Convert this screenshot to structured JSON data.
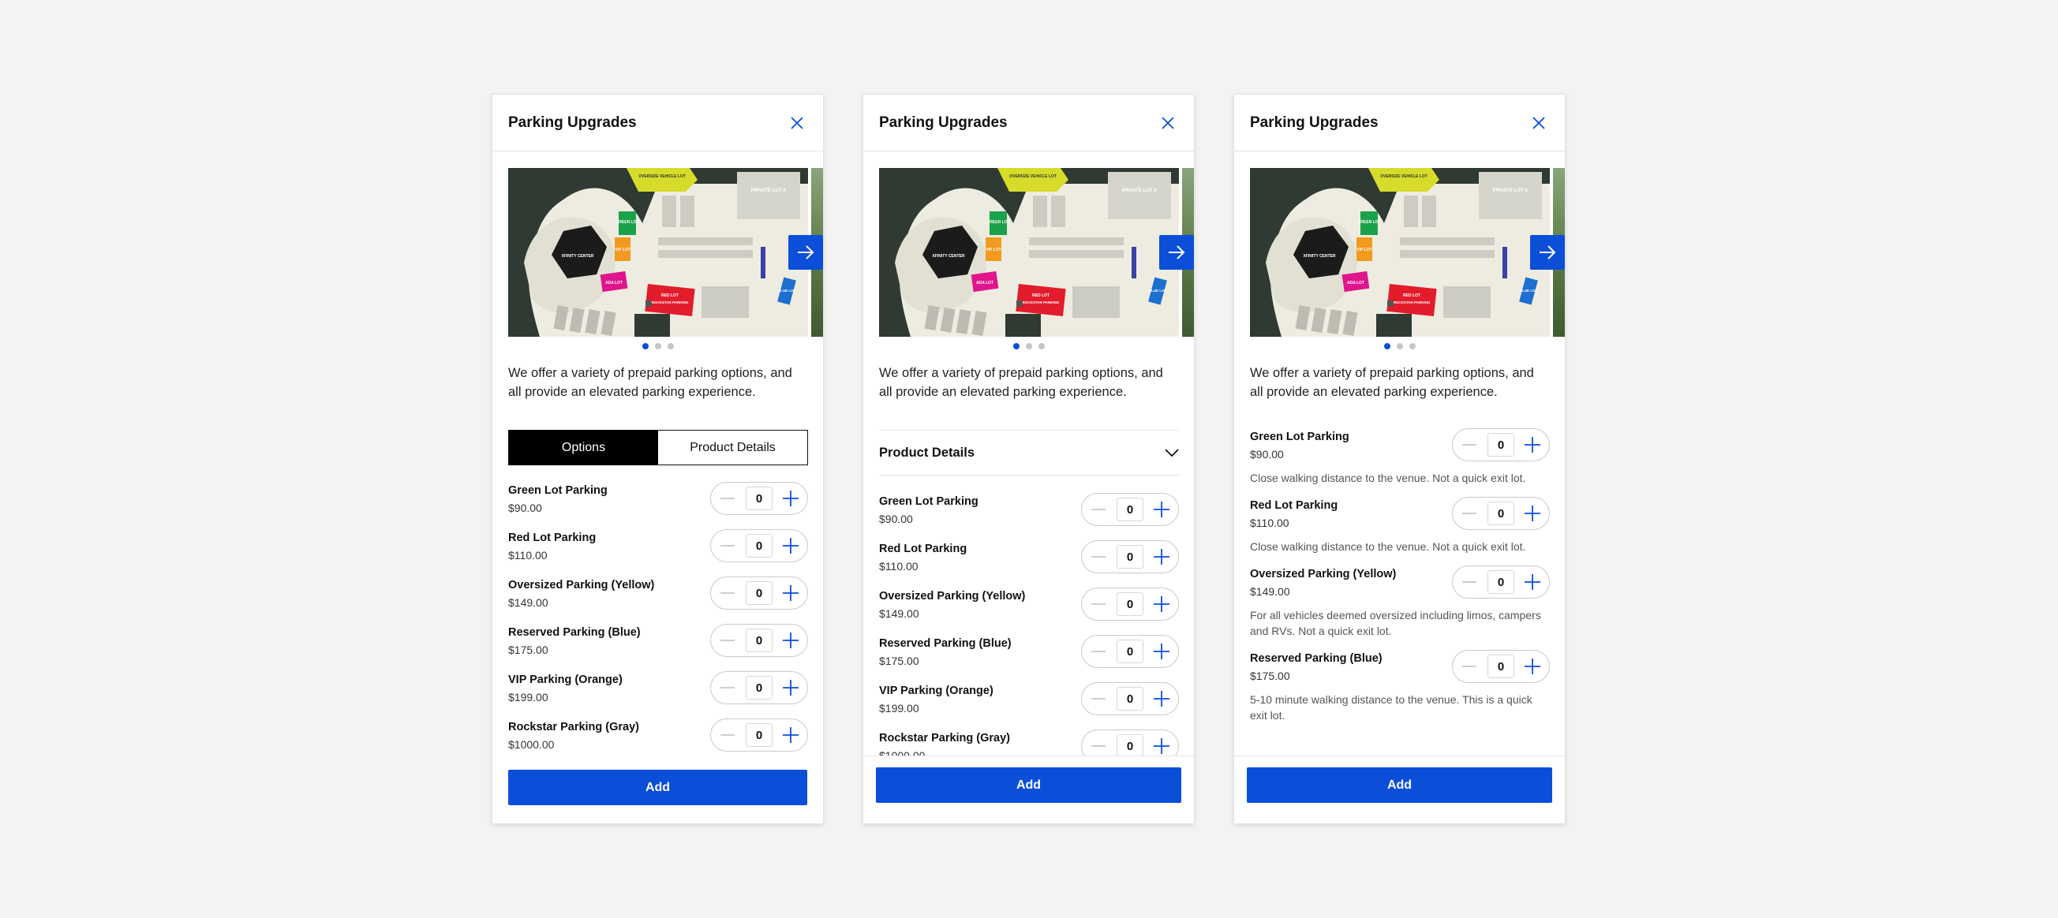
{
  "panels": [
    {
      "title": "Parking Upgrades",
      "intro": "We offer a variety of prepaid parking options, and all provide an elevated parking experience.",
      "tabs": [
        "Options",
        "Product Details"
      ],
      "add_label": "Add",
      "options": [
        {
          "name": "Green Lot Parking",
          "price": "$90.00",
          "qty": "0"
        },
        {
          "name": "Red Lot Parking",
          "price": "$110.00",
          "qty": "0"
        },
        {
          "name": "Oversized Parking (Yellow)",
          "price": "$149.00",
          "qty": "0"
        },
        {
          "name": "Reserved Parking (Blue)",
          "price": "$175.00",
          "qty": "0"
        },
        {
          "name": "VIP Parking (Orange)",
          "price": "$199.00",
          "qty": "0"
        },
        {
          "name": "Rockstar Parking (Gray)",
          "price": "$1000.00",
          "qty": "0"
        }
      ]
    },
    {
      "title": "Parking Upgrades",
      "intro": "We offer a variety of prepaid parking options, and all provide an elevated parking experience.",
      "accordion_label": "Product Details",
      "add_label": "Add",
      "options": [
        {
          "name": "Green Lot Parking",
          "price": "$90.00",
          "qty": "0"
        },
        {
          "name": "Red Lot Parking",
          "price": "$110.00",
          "qty": "0"
        },
        {
          "name": "Oversized Parking (Yellow)",
          "price": "$149.00",
          "qty": "0"
        },
        {
          "name": "Reserved Parking (Blue)",
          "price": "$175.00",
          "qty": "0"
        },
        {
          "name": "VIP Parking (Orange)",
          "price": "$199.00",
          "qty": "0"
        },
        {
          "name": "Rockstar Parking (Gray)",
          "price": "$1000.00",
          "qty": "0"
        }
      ]
    },
    {
      "title": "Parking Upgrades",
      "intro": "We offer a variety of prepaid parking options, and all provide an elevated parking experience.",
      "add_label": "Add",
      "options": [
        {
          "name": "Green Lot Parking",
          "price": "$90.00",
          "qty": "0",
          "desc": "Close walking distance to the venue. Not a quick exit lot."
        },
        {
          "name": "Red Lot Parking",
          "price": "$110.00",
          "qty": "0",
          "desc": "Close walking distance to the venue. Not a quick exit lot."
        },
        {
          "name": "Oversized Parking (Yellow)",
          "price": "$149.00",
          "qty": "0",
          "desc": "For all vehicles deemed oversized including limos, campers and RVs. Not a quick exit lot."
        },
        {
          "name": "Reserved Parking (Blue)",
          "price": "$175.00",
          "qty": "0",
          "desc": "5-10 minute walking distance to the venue. This is a quick exit lot."
        }
      ]
    }
  ],
  "map_labels": {
    "center": "XFINITY CENTER",
    "green": "GREEN LOT",
    "vip": "VIP LOT",
    "ada": "ADA LOT",
    "red": "RED LOT",
    "rockstar": "ROCKSTAR PARKING",
    "blue": "BLUE LOT",
    "oversize": "OVERSIZE VEHICLE LOT",
    "private": "PRIVATE LOT A"
  },
  "carousel": {
    "slide_count": 3,
    "active_index": 0
  },
  "colors": {
    "accent": "#0b4fd9",
    "tab_active_bg": "#000000",
    "green_lot": "#1aa14a",
    "red_lot": "#e21c2b",
    "yellow_lot": "#d7dc2a",
    "blue_lot": "#1d6fd0",
    "orange_lot": "#f29a1f",
    "ada_lot": "#e0148c"
  },
  "icons": {
    "close": "close-icon",
    "next": "arrow-right-icon",
    "minus": "minus-icon",
    "plus": "plus-icon",
    "chevron": "chevron-down-icon"
  }
}
